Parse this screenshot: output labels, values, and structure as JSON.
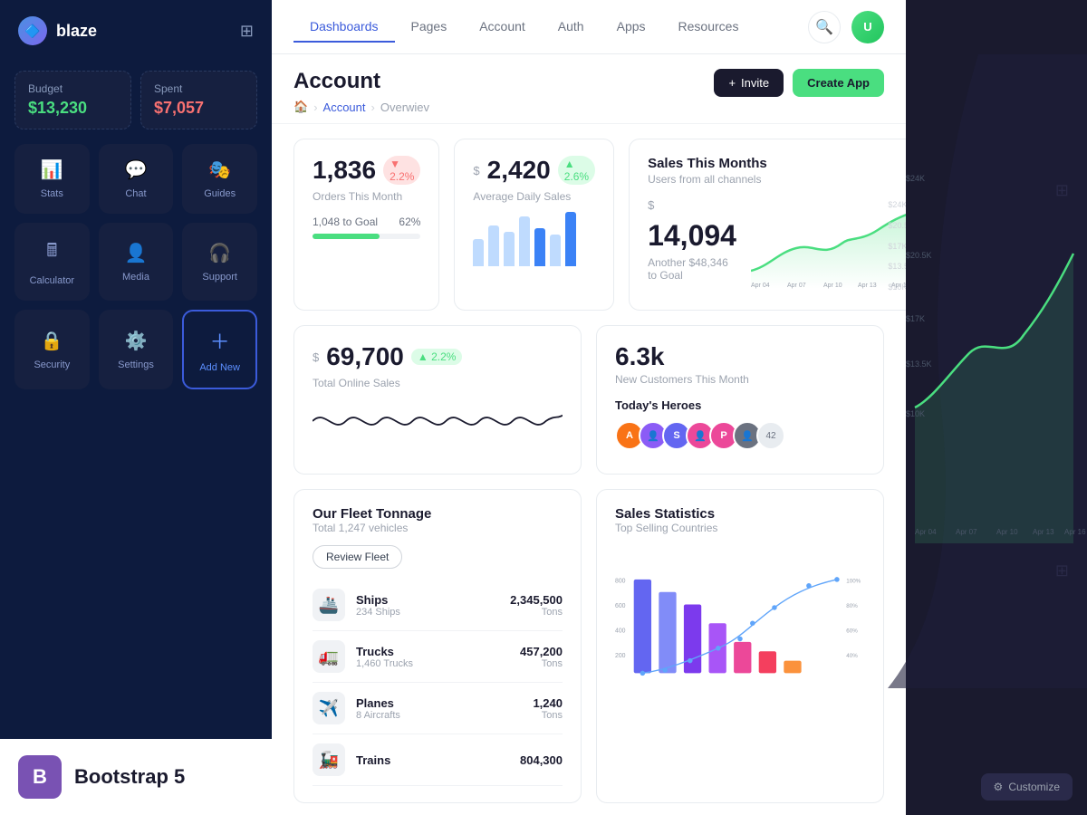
{
  "app": {
    "name": "blaze"
  },
  "sidebar": {
    "budget": {
      "label": "Budget",
      "value": "$13,230"
    },
    "spent": {
      "label": "Spent",
      "value": "$7,057"
    },
    "nav_items": [
      {
        "id": "stats",
        "label": "Stats",
        "icon": "📊"
      },
      {
        "id": "chat",
        "label": "Chat",
        "icon": "💬"
      },
      {
        "id": "guides",
        "label": "Guides",
        "icon": "🎭"
      },
      {
        "id": "calculator",
        "label": "Calculator",
        "icon": "🖩"
      },
      {
        "id": "media",
        "label": "Media",
        "icon": "👤"
      },
      {
        "id": "support",
        "label": "Support",
        "icon": "🎧"
      },
      {
        "id": "security",
        "label": "Security",
        "icon": "🔒"
      },
      {
        "id": "settings",
        "label": "Settings",
        "icon": "⚙️"
      },
      {
        "id": "add-new",
        "label": "Add New",
        "icon": "+"
      }
    ]
  },
  "topnav": {
    "links": [
      {
        "id": "dashboards",
        "label": "Dashboards",
        "active": true
      },
      {
        "id": "pages",
        "label": "Pages",
        "active": false
      },
      {
        "id": "account",
        "label": "Account",
        "active": false
      },
      {
        "id": "auth",
        "label": "Auth",
        "active": false
      },
      {
        "id": "apps",
        "label": "Apps",
        "active": false
      },
      {
        "id": "resources",
        "label": "Resources",
        "active": false
      }
    ]
  },
  "page": {
    "title": "Account",
    "breadcrumb": [
      "Home",
      "Account",
      "Overwiev"
    ],
    "actions": {
      "invite": "Invite",
      "create_app": "Create App"
    }
  },
  "stats": {
    "orders": {
      "value": "1,836",
      "badge": "▼ 2.2%",
      "label": "Orders This Month",
      "progress_label": "1,048 to Goal",
      "progress_pct": "62%",
      "progress_val": 62
    },
    "daily_sales": {
      "prefix": "$",
      "value": "2,420",
      "badge": "▲ 2.6%",
      "label": "Average Daily Sales"
    },
    "sales_month": {
      "title": "Sales This Months",
      "subtitle": "Users from all channels",
      "prefix": "$",
      "value": "14,094",
      "goal_text": "Another $48,346 to Goal",
      "y_labels": [
        "$24K",
        "$20.5K",
        "$17K",
        "$13.5K",
        "$10K"
      ],
      "x_labels": [
        "Apr 04",
        "Apr 07",
        "Apr 10",
        "Apr 13",
        "Apr 16"
      ]
    }
  },
  "online_sales": {
    "prefix": "$",
    "value": "69,700",
    "badge": "▲ 2.2%",
    "label": "Total Online Sales"
  },
  "customers": {
    "value": "6.3k",
    "label": "New Customers This Month",
    "heroes_title": "Today's Heroes",
    "heroes": [
      {
        "initial": "A",
        "color": "#f97316"
      },
      {
        "color": "photo1"
      },
      {
        "initial": "S",
        "color": "#6366f1"
      },
      {
        "color": "photo2"
      },
      {
        "initial": "P",
        "color": "#ec4899"
      },
      {
        "color": "photo3"
      },
      {
        "count": "42"
      }
    ]
  },
  "fleet": {
    "title": "Our Fleet Tonnage",
    "subtitle": "Total 1,247 vehicles",
    "review_btn": "Review Fleet",
    "items": [
      {
        "icon": "🚢",
        "name": "Ships",
        "count": "234 Ships",
        "amount": "2,345,500",
        "unit": "Tons"
      },
      {
        "icon": "🚛",
        "name": "Trucks",
        "count": "1,460 Trucks",
        "amount": "457,200",
        "unit": "Tons"
      },
      {
        "icon": "✈️",
        "name": "Planes",
        "count": "8 Aircrafts",
        "amount": "1,240",
        "unit": "Tons"
      },
      {
        "icon": "🚂",
        "name": "Trains",
        "count": "",
        "amount": "804,300",
        "unit": ""
      }
    ]
  },
  "sales_stats": {
    "title": "Sales Statistics",
    "subtitle": "Top Selling Countries"
  },
  "bootstrap_badge": {
    "letter": "B",
    "text": "Bootstrap 5"
  },
  "customize_btn": "Customize"
}
